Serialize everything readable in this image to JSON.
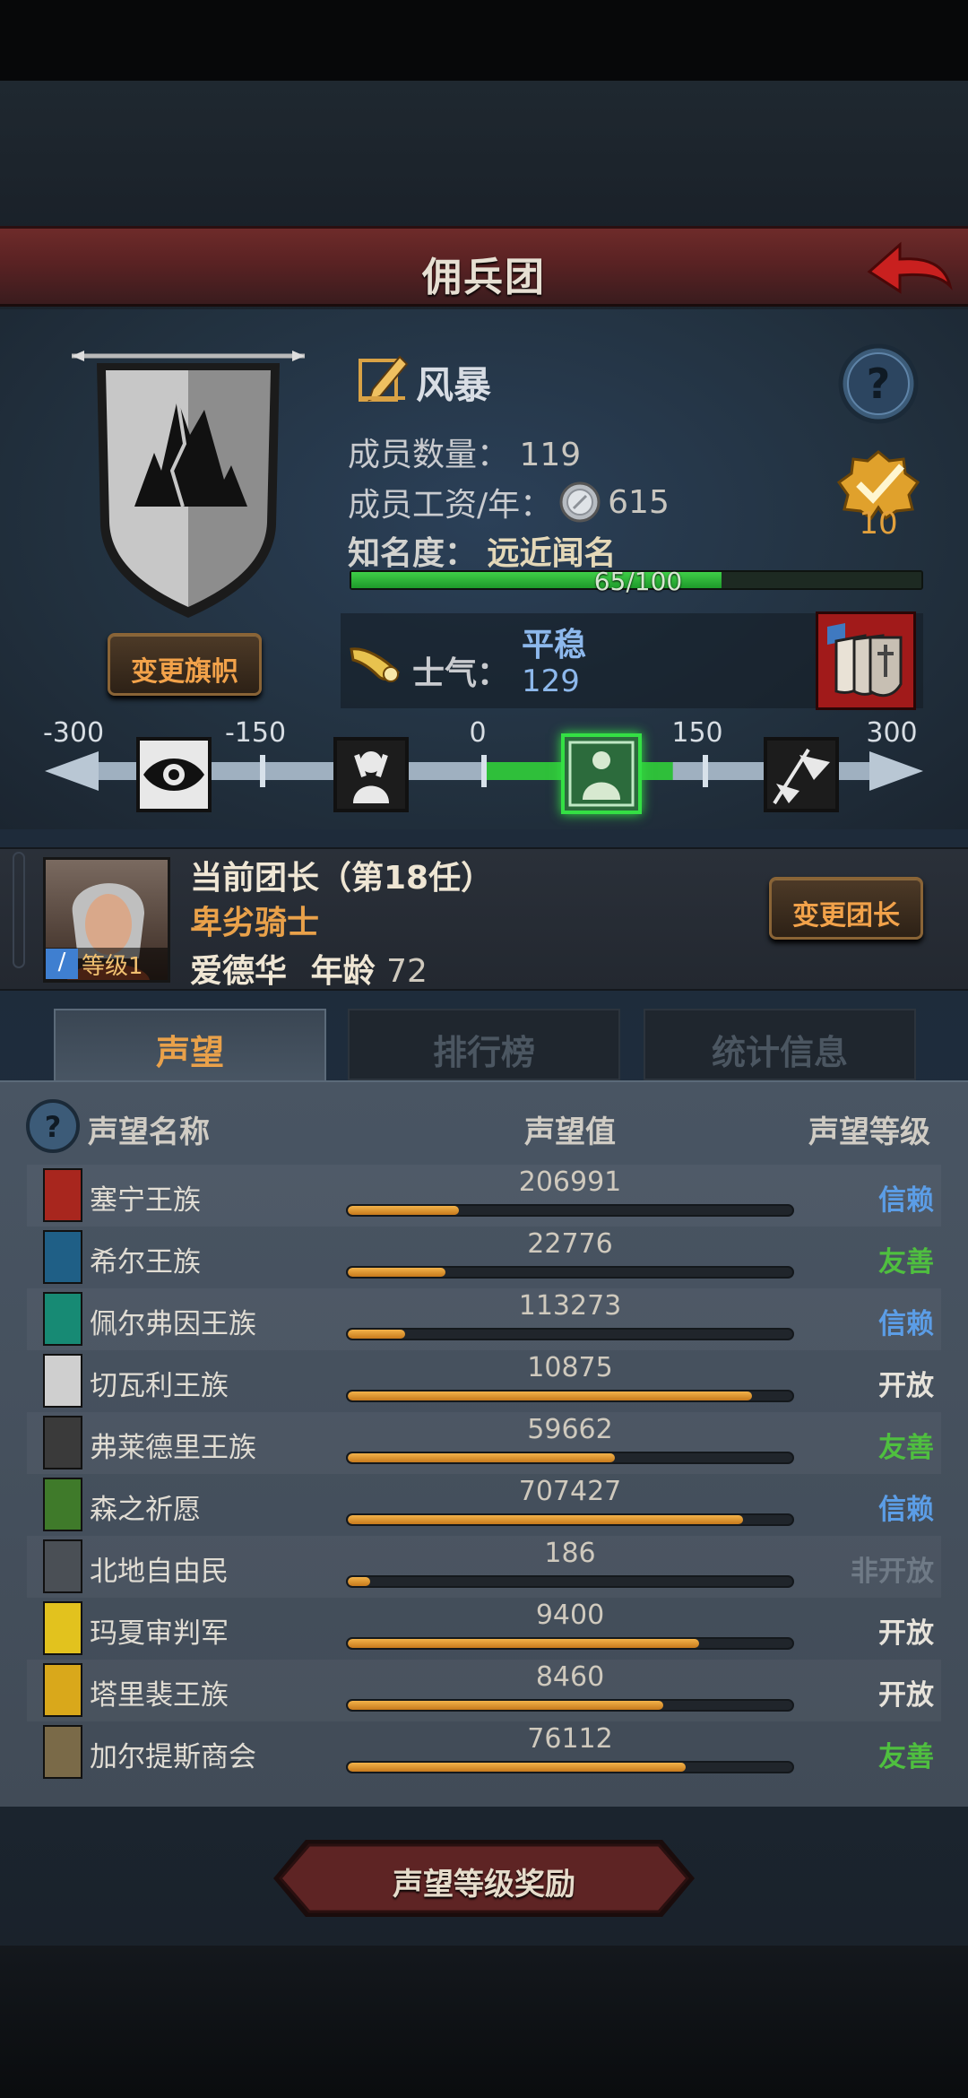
{
  "header": {
    "title": "佣兵团"
  },
  "banner": {
    "change_button": "变更旗帜"
  },
  "guild": {
    "name": "风暴",
    "members_label": "成员数量：",
    "members_value": "119",
    "salary_label": "成员工资/年：",
    "salary_value": "615",
    "fame_label": "知名度：",
    "fame_value": "远近闻名",
    "fame_progress_text": "65/100",
    "fame_progress": 0.65,
    "achievement_count": "10",
    "morale_label": "士气：",
    "morale_state": "平稳",
    "morale_value": "129"
  },
  "morale_scale": {
    "ticks": [
      "-300",
      "-150",
      "0",
      "150",
      "300"
    ],
    "current_value": 129
  },
  "leader": {
    "title": "当前团长（第18任）",
    "class_name": "卑劣骑士",
    "name": "爱德华",
    "age_label": "年龄",
    "age_value": "72",
    "level_label": "等级1",
    "change_button": "变更团长"
  },
  "tabs": [
    "声望",
    "排行榜",
    "统计信息"
  ],
  "reputation": {
    "headers": {
      "name": "声望名称",
      "value": "声望值",
      "level": "声望等级"
    },
    "rows": [
      {
        "name": "塞宁王族",
        "value": "206991",
        "level": "信赖",
        "level_color": "#5b9de6",
        "fill": 0.25,
        "emblem_color": "#a8261e"
      },
      {
        "name": "希尔王族",
        "value": "22776",
        "level": "友善",
        "level_color": "#4fbf3f",
        "fill": 0.22,
        "emblem_color": "#1f5f86"
      },
      {
        "name": "佩尔弗因王族",
        "value": "113273",
        "level": "信赖",
        "level_color": "#5b9de6",
        "fill": 0.13,
        "emblem_color": "#178a74"
      },
      {
        "name": "切瓦利王族",
        "value": "10875",
        "level": "开放",
        "level_color": "#e6e2da",
        "fill": 0.91,
        "emblem_color": "#cfcfcf"
      },
      {
        "name": "弗莱德里王族",
        "value": "59662",
        "level": "友善",
        "level_color": "#4fbf3f",
        "fill": 0.6,
        "emblem_color": "#3a3a3a"
      },
      {
        "name": "森之祈愿",
        "value": "707427",
        "level": "信赖",
        "level_color": "#5b9de6",
        "fill": 0.89,
        "emblem_color": "#3f7a2a"
      },
      {
        "name": "北地自由民",
        "value": "186",
        "level": "非开放",
        "level_color": "#6f7a86",
        "fill": 0.05,
        "emblem_color": "#4a4f55"
      },
      {
        "name": "玛夏审判军",
        "value": "9400",
        "level": "开放",
        "level_color": "#e6e2da",
        "fill": 0.79,
        "emblem_color": "#e2c21e"
      },
      {
        "name": "塔里裴王族",
        "value": "8460",
        "level": "开放",
        "level_color": "#e6e2da",
        "fill": 0.71,
        "emblem_color": "#d9a81b"
      },
      {
        "name": "加尔提斯商会",
        "value": "76112",
        "level": "友善",
        "level_color": "#4fbf3f",
        "fill": 0.76,
        "emblem_color": "#7a6a48"
      }
    ]
  },
  "footer": {
    "reward_button": "声望等级奖励"
  },
  "icons": {
    "back": "back-arrow-icon",
    "help": "help-icon",
    "edit": "edit-pencil-icon",
    "coin": "silver-coin-icon",
    "horn": "horn-icon",
    "achievement": "achievement-badge-icon",
    "tactics": "tactics-shields-icon"
  },
  "colors": {
    "accent_orange": "#f2a24a",
    "fame_green": "#2fbf3a",
    "title_red": "#6e2b2a",
    "morale_blue": "#8db8ec"
  }
}
